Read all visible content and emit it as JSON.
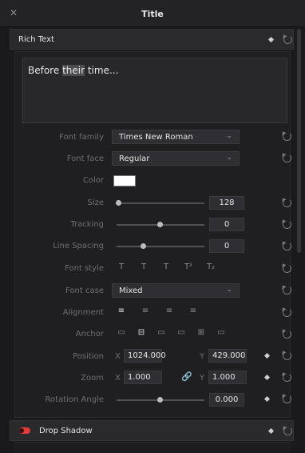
{
  "window": {
    "close_icon": "close-icon",
    "title": "Title"
  },
  "rich_text": {
    "header": "Rich Text",
    "text_before": "Before ",
    "text_highlight": "their",
    "text_after": " time..."
  },
  "rows": {
    "font_family": {
      "label": "Font family",
      "value": "Times New Roman"
    },
    "font_face": {
      "label": "Font face",
      "value": "Regular"
    },
    "color": {
      "label": "Color",
      "swatch": "#ffffff"
    },
    "size": {
      "label": "Size",
      "value": "128",
      "level": 0.0
    },
    "tracking": {
      "label": "Tracking",
      "value": "0",
      "level": 0.5
    },
    "line_spacing": {
      "label": "Line Spacing",
      "value": "0",
      "level": 0.3
    },
    "font_style": {
      "label": "Font style"
    },
    "font_case": {
      "label": "Font case",
      "value": "Mixed"
    },
    "alignment": {
      "label": "Alignment"
    },
    "anchor": {
      "label": "Anchor"
    },
    "position": {
      "label": "Position",
      "x_label": "X",
      "x": "1024.000",
      "y_label": "Y",
      "y": "429.000"
    },
    "zoom": {
      "label": "Zoom",
      "x_label": "X",
      "x": "1.000",
      "y_label": "Y",
      "y": "1.000"
    },
    "rotation": {
      "label": "Rotation Angle",
      "value": "0.000",
      "level": 0.5
    }
  },
  "drop_shadow": {
    "header": "Drop Shadow",
    "enabled_color": "#e23b3b"
  },
  "font_style_glyphs": [
    "T",
    "T",
    "T",
    "T²",
    "T₂"
  ],
  "alignment_glyphs": [
    "≡",
    "≡",
    "≡",
    "≡"
  ],
  "anchor_glyphs": [
    "▭",
    "⊟",
    "▭",
    "▭",
    "⊞",
    "▭"
  ]
}
